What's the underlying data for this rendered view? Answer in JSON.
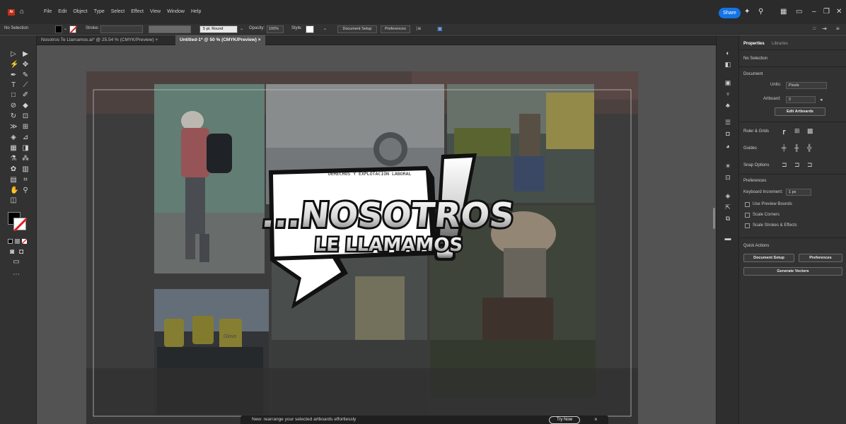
{
  "menubar": {
    "app_logo": "Ai",
    "items": [
      "File",
      "Edit",
      "Object",
      "Type",
      "Select",
      "Effect",
      "View",
      "Window",
      "Help"
    ],
    "share_label": "Share"
  },
  "control": {
    "selection": "No Selection",
    "stroke_label": "Stroke:",
    "brush": "5 pt. Round",
    "opacity_label": "Opacity:",
    "opacity_value": "100%",
    "style_label": "Style:",
    "document_setup": "Document Setup",
    "preferences": "Preferences"
  },
  "tabs": [
    {
      "label": "Nosotros Te Llamamos.ai* @ 25.54 % (CMYK/Preview)",
      "close": "×"
    },
    {
      "label": "Untitled-1* @ 50 % (CMYK/Preview)",
      "close": "×"
    }
  ],
  "artwork": {
    "kicker": "DERECHOS Y EXPLOTACIÓN LABORAL",
    "title_line1": "...NOSOTROS",
    "title_line2": "LE LLAMAMOS",
    "exclaim": "!",
    "bag_text": "Glovo"
  },
  "properties": {
    "tab_properties": "Properties",
    "tab_libraries": "Libraries",
    "no_selection": "No Selection",
    "document": "Document",
    "units_label": "Units:",
    "units_value": "Pixels",
    "artboard_label": "Artboard:",
    "artboard_value": "2",
    "edit_artboards": "Edit Artboards",
    "ruler_grids": "Ruler & Grids",
    "guides": "Guides",
    "snap_options": "Snap Options",
    "preferences": "Preferences",
    "keyboard_increment_label": "Keyboard Increment:",
    "keyboard_increment_value": "1 px",
    "use_preview_bounds": "Use Preview Bounds",
    "scale_corners": "Scale Corners",
    "scale_strokes": "Scale Strokes & Effects",
    "quick_actions": "Quick Actions",
    "document_setup": "Document Setup",
    "preferences_btn": "Preferences",
    "generate_vectors": "Generate Vectors"
  },
  "toast": {
    "message": "New: rearrange your selected artboards effortlessly",
    "button": "Try Now",
    "close": "×"
  },
  "colors": {
    "accent": "#1473e6",
    "app_logo": "#c42c17",
    "panel": "#323232",
    "canvas": "#535353"
  }
}
